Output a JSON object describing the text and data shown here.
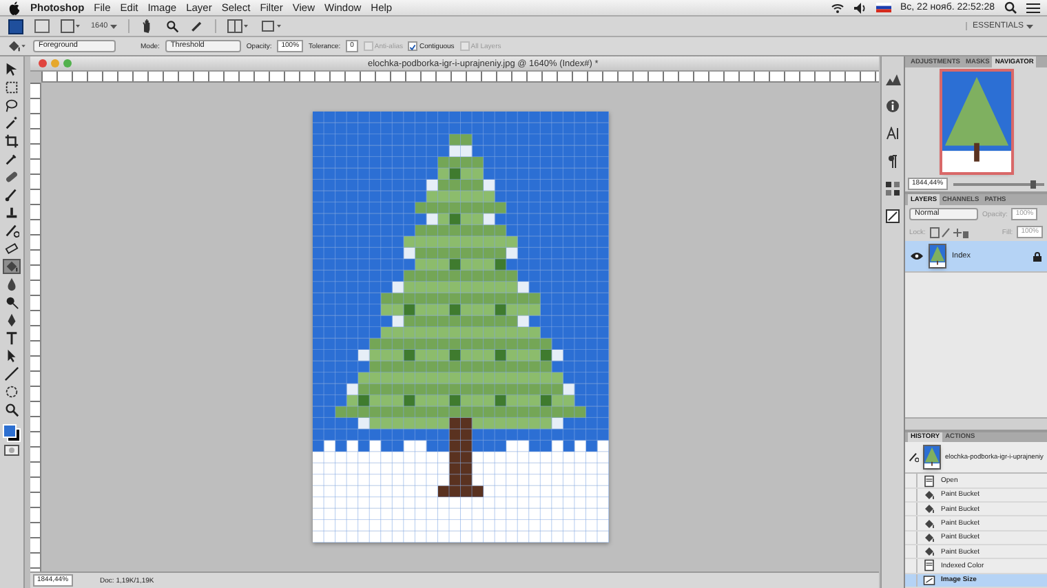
{
  "menu_bar": {
    "app": "Photoshop",
    "items": [
      "File",
      "Edit",
      "Image",
      "Layer",
      "Select",
      "Filter",
      "View",
      "Window",
      "Help"
    ],
    "clock": "Вс, 22 нояб. 22:52:28"
  },
  "app_bar": {
    "zoom": "1640",
    "workspace": "ESSENTIALS"
  },
  "options_bar": {
    "fill_source": "Foreground",
    "mode_label": "Mode:",
    "mode": "Threshold",
    "opacity_label": "Opacity:",
    "opacity": "100%",
    "tolerance_label": "Tolerance:",
    "tolerance": "0",
    "checkboxes": [
      {
        "label": "Anti-alias",
        "checked": false,
        "disabled": true
      },
      {
        "label": "Contiguous",
        "checked": true,
        "disabled": false
      },
      {
        "label": "All Layers",
        "checked": false,
        "disabled": true
      }
    ]
  },
  "tools": [
    {
      "kind": "move",
      "selected": false
    },
    {
      "kind": "marquee",
      "selected": false
    },
    {
      "kind": "lasso",
      "selected": false
    },
    {
      "kind": "wand",
      "selected": false
    },
    {
      "kind": "crop",
      "selected": false
    },
    {
      "kind": "eyedropper",
      "selected": false
    },
    {
      "kind": "healing",
      "selected": false
    },
    {
      "kind": "brush",
      "selected": false
    },
    {
      "kind": "stamp",
      "selected": false
    },
    {
      "kind": "history",
      "selected": false
    },
    {
      "kind": "eraser",
      "selected": false
    },
    {
      "kind": "bucket",
      "selected": true
    },
    {
      "kind": "blur",
      "selected": false
    },
    {
      "kind": "dodge",
      "selected": false
    },
    {
      "kind": "pen",
      "selected": false
    },
    {
      "kind": "type",
      "selected": false
    },
    {
      "kind": "select",
      "selected": false
    },
    {
      "kind": "line",
      "selected": false
    },
    {
      "kind": "rotate",
      "selected": false
    },
    {
      "kind": "zoom",
      "selected": false
    }
  ],
  "document": {
    "title": "elochka-podborka-igr-i-uprajneniy.jpg @ 1640% (Index#) *"
  },
  "status_bar": {
    "zoom": "1844,44%",
    "doc": "Doc: 1,19K/1,19K"
  },
  "navigator": {
    "tabs": [
      {
        "label": "ADJUSTMENTS",
        "selected": false
      },
      {
        "label": "MASKS",
        "selected": false
      },
      {
        "label": "NAVIGATOR",
        "selected": true
      }
    ],
    "zoom": "1844,44%",
    "zoom_slider": {
      "level": 0.88
    }
  },
  "layers": {
    "tabs": [
      {
        "label": "LAYERS",
        "selected": true
      },
      {
        "label": "CHANNELS",
        "selected": false
      },
      {
        "label": "PATHS",
        "selected": false
      }
    ],
    "blend_mode": "Normal",
    "opacity_label": "Opacity:",
    "opacity": "100%",
    "lock_label": "Lock:",
    "fill_label": "Fill:",
    "fill": "100%",
    "items": [
      {
        "name": "Index",
        "visible": true,
        "selected": true,
        "locked": true
      }
    ]
  },
  "history": {
    "tabs": [
      {
        "label": "HISTORY",
        "selected": true
      },
      {
        "label": "ACTIONS",
        "selected": false
      }
    ],
    "snapshot": "elochka-podborka-igr-i-uprajneniy",
    "items": [
      {
        "label": "Open",
        "kind": "document",
        "selected": false
      },
      {
        "label": "Paint Bucket",
        "kind": "bucket",
        "selected": false
      },
      {
        "label": "Paint Bucket",
        "kind": "bucket",
        "selected": false
      },
      {
        "label": "Paint Bucket",
        "kind": "bucket",
        "selected": false
      },
      {
        "label": "Paint Bucket",
        "kind": "bucket",
        "selected": false
      },
      {
        "label": "Paint Bucket",
        "kind": "bucket",
        "selected": false
      },
      {
        "label": "Indexed Color",
        "kind": "document",
        "selected": false
      },
      {
        "label": "Image Size",
        "kind": "resize",
        "selected": true
      }
    ]
  }
}
